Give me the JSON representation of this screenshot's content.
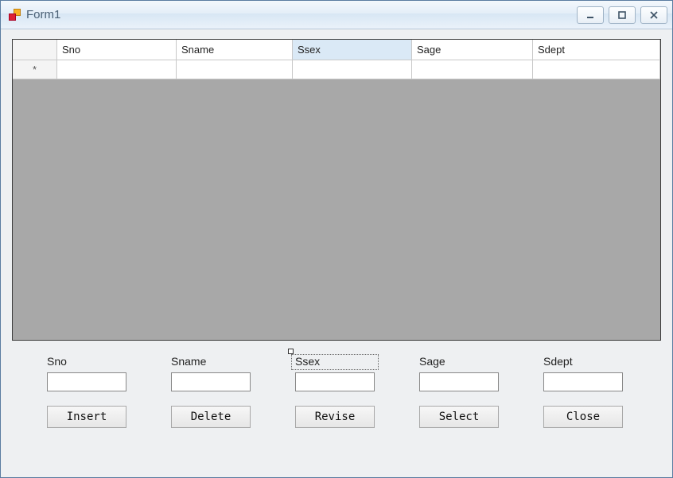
{
  "window": {
    "title": "Form1"
  },
  "grid": {
    "columns": [
      "Sno",
      "Sname",
      "Ssex",
      "Sage",
      "Sdept"
    ],
    "selected_column_index": 2,
    "new_row_indicator": "*",
    "rows": [
      {
        "Sno": "",
        "Sname": "",
        "Ssex": "",
        "Sage": "",
        "Sdept": ""
      }
    ]
  },
  "fields": [
    {
      "label": "Sno",
      "value": ""
    },
    {
      "label": "Sname",
      "value": ""
    },
    {
      "label": "Ssex",
      "value": "",
      "designer_selected": true
    },
    {
      "label": "Sage",
      "value": ""
    },
    {
      "label": "Sdept",
      "value": ""
    }
  ],
  "buttons": {
    "insert": "Insert",
    "delete": "Delete",
    "revise": "Revise",
    "select": "Select",
    "close": "Close"
  }
}
